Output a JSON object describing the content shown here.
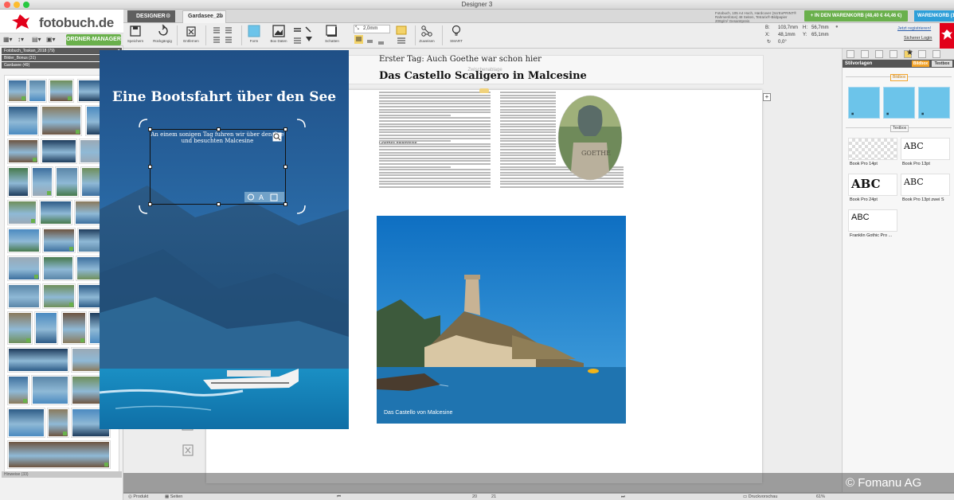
{
  "window": {
    "title": "Designer 3"
  },
  "brand": {
    "name": "fotobuch.de"
  },
  "left_panel": {
    "ordner_button": "ORDNER-MANAGER",
    "folders": [
      {
        "label": "Fotobuch_Toskan_2018 (79)"
      },
      {
        "label": "Bilder_Bonus (31)"
      },
      {
        "label": "Gardasee (49)"
      }
    ],
    "bottom_label": "Hinweise (33)"
  },
  "tabs": {
    "designer": "DESIGNER",
    "file": "Gardasee_2b"
  },
  "cart": {
    "info": "Fotobuch, 105 A4 Hoch, Hardcover (ScrEoPRINT® Rahmenfotos) 48 Seiten, Tetrarix®-Bildpapier 200g/m² Gesamtpreis",
    "add_button": "+ IN DEN WARENKORB (48,40 € 44,46 €)",
    "cart_button": "WARENKORB (1)"
  },
  "toolbar": {
    "items": [
      "Speichern",
      "Rückgängig",
      "Entfernen",
      "",
      "Form",
      "Box Daten",
      "",
      "Schatten",
      "",
      "Zuweisen",
      "SMART"
    ],
    "stroke_value": "2,0mm"
  },
  "coords": {
    "b_label": "B:",
    "b_value": "103,7mm",
    "h_label": "H:",
    "h_value": "56,7mm",
    "x_label": "X:",
    "x_value": "48,1mm",
    "y_label": "Y:",
    "y_value": "65,1mm",
    "rot_value": "0,0°",
    "registered_link": "Jetzt registrieren!",
    "login_link": "Sicherer Login"
  },
  "workspace": {
    "clipboard_label": "Zwischenablage"
  },
  "left_page": {
    "title": "Eine Bootsfahrt über den See",
    "subtitle": "An einem sonigen Tag fuhren wir über den See und besuchten Malcesine"
  },
  "right_page": {
    "kicker": "Erster Tag: Auch Goethe war schon hier",
    "title": "Das Castello Scaligero in Malcesine",
    "body_heading": "Goethes Italienreise",
    "caption": "Das Castello von Malcesine"
  },
  "right_panel": {
    "header": "Stilvorlagen",
    "tab_bildbox": "Bildbox",
    "tab_textbox": "Textbox",
    "section_bildbox": "Bildbox",
    "section_textbox": "Textbox",
    "text_styles": [
      {
        "sample": "",
        "label": "Book Pro 14pt"
      },
      {
        "sample": "ABC",
        "label": "Book Pro 13pt"
      },
      {
        "sample": "ABC",
        "label": "Book Pro 24pt"
      },
      {
        "sample": "ABC",
        "label": "Book Pro 13pt zwei S"
      },
      {
        "sample": "ABC",
        "label": "Franklin Gothic Pro ..."
      }
    ]
  },
  "status": {
    "produkt": "Produkt",
    "seiten": "Seiten",
    "page_from": "20",
    "page_to": "21",
    "druckvorschau": "Druckvorschau",
    "zoom": "61%"
  },
  "watermark": "© Fomanu AG",
  "colors": {
    "green": "#6ab04c",
    "blue": "#2e9fd8",
    "red": "#e2001a",
    "orange": "#f3a42a",
    "swatch": "#6cc4ea"
  }
}
